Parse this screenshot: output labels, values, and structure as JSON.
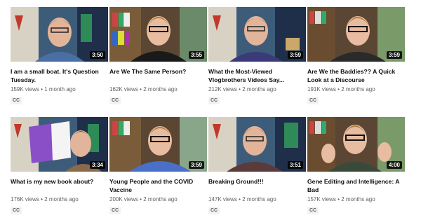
{
  "videos": [
    {
      "title": "I am a small boat. It's Question Tuesday.",
      "views": "159K views",
      "age": "1 month ago",
      "duration": "3:50",
      "badge": "CC"
    },
    {
      "title": "Are We The Same Person?",
      "views": "162K views",
      "age": "2 months ago",
      "duration": "3:55",
      "badge": "CC"
    },
    {
      "title": "What the Most-Viewed Vlogbrothers Videos Say...",
      "views": "212K views",
      "age": "2 months ago",
      "duration": "3:59",
      "badge": "CC"
    },
    {
      "title": "Are We the Baddies?? A Quick Look at a Discourse",
      "views": "191K views",
      "age": "2 months ago",
      "duration": "3:59",
      "badge": "CC"
    },
    {
      "title": "What is my new book about?",
      "views": "176K views",
      "age": "2 months ago",
      "duration": "3:34",
      "badge": "CC"
    },
    {
      "title": "Young People and the COVID Vaccine",
      "views": "200K views",
      "age": "2 months ago",
      "duration": "3:59",
      "badge": "CC"
    },
    {
      "title": "Breaking Ground!!!",
      "views": "147K views",
      "age": "2 months ago",
      "duration": "3:51",
      "badge": "CC"
    },
    {
      "title": "Gene Editing and Intelligence: A Bad",
      "views": "157K views",
      "age": "2 months ago",
      "duration": "4:00",
      "badge": "CC"
    }
  ],
  "separator": "•"
}
